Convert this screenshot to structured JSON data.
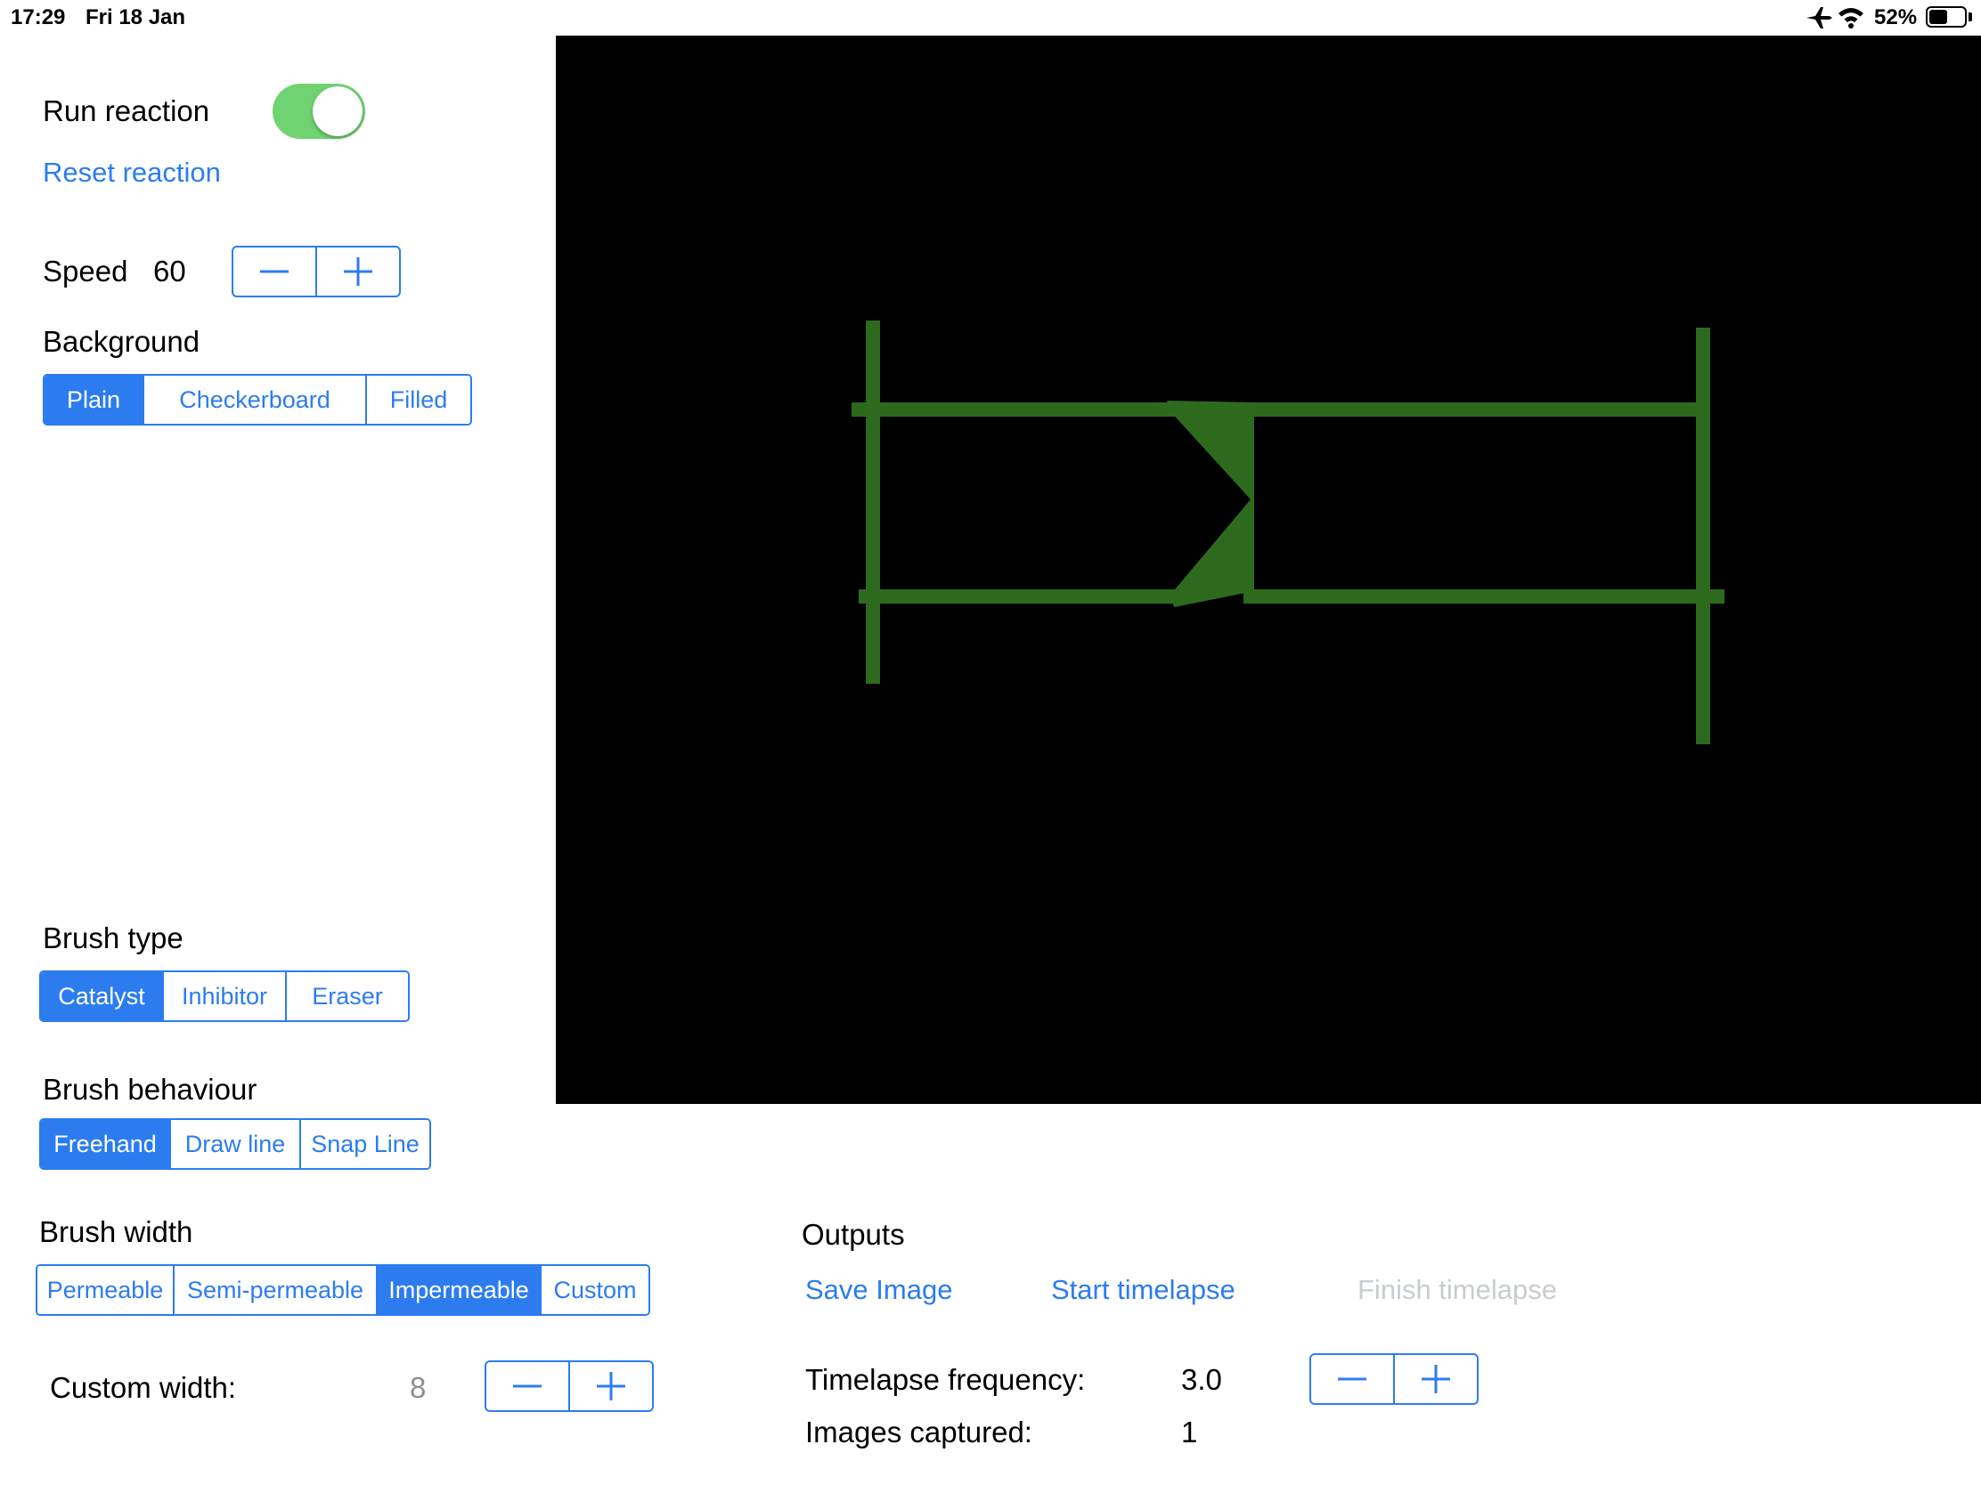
{
  "status_bar": {
    "time": "17:29",
    "date": "Fri 18 Jan",
    "battery_percent": "52%",
    "battery_level": 0.52
  },
  "reaction": {
    "run_label": "Run reaction",
    "run_on": true,
    "reset_label": "Reset reaction"
  },
  "speed": {
    "label": "Speed",
    "value": "60"
  },
  "background": {
    "label": "Background",
    "options": [
      "Plain",
      "Checkerboard",
      "Filled"
    ],
    "selected": "Plain"
  },
  "brush_type": {
    "label": "Brush type",
    "options": [
      "Catalyst",
      "Inhibitor",
      "Eraser"
    ],
    "selected": "Catalyst"
  },
  "brush_behaviour": {
    "label": "Brush behaviour",
    "options": [
      "Freehand",
      "Draw line",
      "Snap Line"
    ],
    "selected": "Freehand"
  },
  "brush_width": {
    "label": "Brush width",
    "options": [
      "Permeable",
      "Semi-permeable",
      "Impermeable",
      "Custom"
    ],
    "selected": "Impermeable"
  },
  "custom_width": {
    "label": "Custom width:",
    "value": "8"
  },
  "outputs": {
    "label": "Outputs",
    "save_image": "Save Image",
    "start_timelapse": "Start timelapse",
    "finish_timelapse": "Finish timelapse",
    "timelapse_frequency_label": "Timelapse frequency:",
    "timelapse_frequency_value": "3.0",
    "images_captured_label": "Images captured:",
    "images_captured_value": "1"
  },
  "canvas": {
    "background_color": "#000000",
    "drawing_color": "#2e6a1e"
  }
}
